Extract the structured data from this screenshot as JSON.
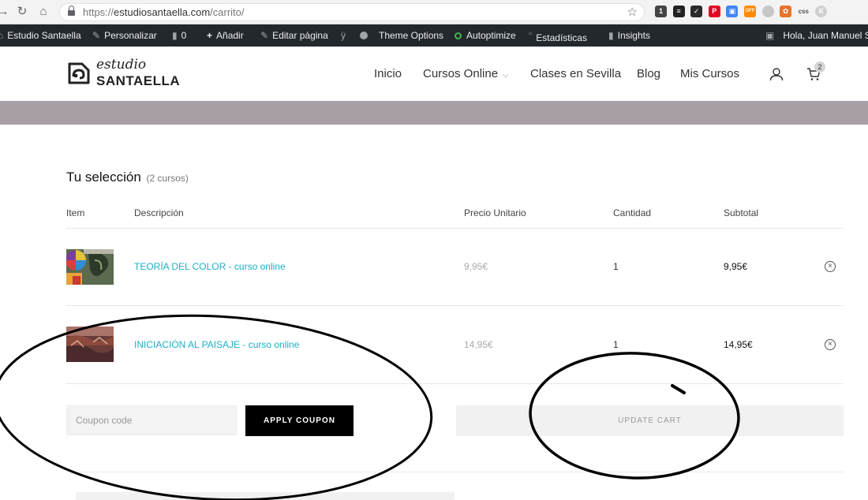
{
  "browser": {
    "url_scheme": "https://",
    "url_host": "estudiosantaella.com",
    "url_path": "/carrito/",
    "extensions": [
      {
        "icon": "extension-1-icon",
        "label": "1",
        "color": "#444444"
      },
      {
        "icon": "buffer-icon",
        "label": "≡",
        "color": "#222222"
      },
      {
        "icon": "checkmark-icon",
        "label": "✓",
        "color": "#2b2b2b"
      },
      {
        "icon": "pinterest-icon",
        "label": "P",
        "color": "#e60023"
      },
      {
        "icon": "extension-screen-icon",
        "label": "▣",
        "color": "#4285f4"
      },
      {
        "icon": "off-icon",
        "label": "OFF",
        "color": "#ff8a00"
      },
      {
        "icon": "circle-grey-icon",
        "label": "",
        "color": "#c7c7c7"
      },
      {
        "icon": "flower-icon",
        "label": "✿",
        "color": "#e8732d"
      },
      {
        "icon": "css-icon",
        "label": "css",
        "color": "#f3f3f3"
      },
      {
        "icon": "profile-icon",
        "label": "K",
        "color": "#cfcfcf"
      }
    ]
  },
  "admin_bar": {
    "site": "Estudio Santaella",
    "customize": "Personalizar",
    "comments": "0",
    "add_new": "Añadir",
    "edit_page": "Editar página",
    "theme_options": "Theme Options",
    "autoptimize": "Autoptimize",
    "stats": "Estadísticas",
    "insights": "Insights",
    "greeting": "Hola, Juan Manuel S"
  },
  "header": {
    "logo_top": "estudio",
    "logo_bottom": "SANTAELLA",
    "menu": [
      "Inicio",
      "Cursos Online",
      "Clases en Sevilla",
      "Blog",
      "Mis Cursos"
    ],
    "cart_count": "2"
  },
  "cart": {
    "title": "Tu selección",
    "count_label": "(2 cursos)",
    "columns": {
      "item": "Item",
      "description": "Descripción",
      "unit_price": "Precio Unitario",
      "quantity": "Cantidad",
      "subtotal": "Subtotal"
    },
    "items": [
      {
        "name": "TEORÍA DEL COLOR - curso online",
        "unit_price": "9,95€",
        "quantity": "1",
        "subtotal": "9,95€"
      },
      {
        "name": "INICIACIÓN AL PAISAJE - curso online",
        "unit_price": "14,95€",
        "quantity": "1",
        "subtotal": "14,95€"
      }
    ],
    "remove_glyph": "×",
    "coupon_placeholder": "Coupon code",
    "apply_label": "APPLY COUPON",
    "update_label": "UPDATE CART"
  },
  "colors": {
    "accent": "#1ab0c6",
    "hero_band": "#a89fa7",
    "admin_bar": "#23282d"
  }
}
